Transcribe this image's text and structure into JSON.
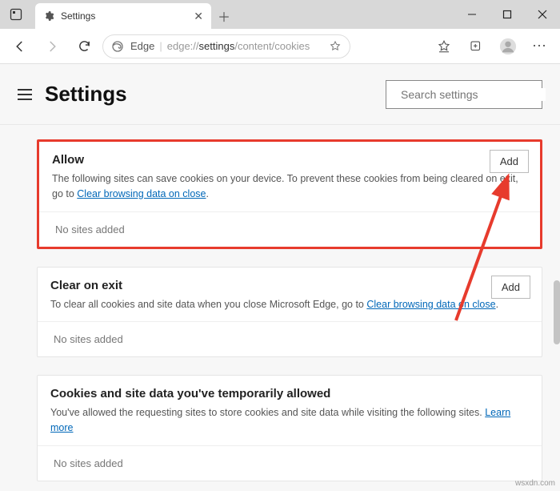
{
  "titlebar": {
    "tab_title": "Settings"
  },
  "toolbar": {
    "addr_label": "Edge",
    "addr_prefix": "edge://",
    "addr_bold": "settings",
    "addr_rest": "/content/cookies"
  },
  "header": {
    "title": "Settings",
    "search_placeholder": "Search settings"
  },
  "cards": {
    "allow": {
      "title": "Allow",
      "desc_pre": "The following sites can save cookies on your device. To prevent these cookies from being cleared on exit, go to ",
      "link": "Clear browsing data on close",
      "desc_post": ".",
      "add": "Add",
      "empty": "No sites added"
    },
    "clear": {
      "title": "Clear on exit",
      "desc_pre": "To clear all cookies and site data when you close Microsoft Edge, go to ",
      "link": "Clear browsing data on close",
      "desc_post": ".",
      "add": "Add",
      "empty": "No sites added"
    },
    "temp": {
      "title": "Cookies and site data you've temporarily allowed",
      "desc_pre": "You've allowed the requesting sites to store cookies and site data while visiting the following sites. ",
      "link": "Learn more",
      "empty": "No sites added"
    }
  },
  "watermark": "wsxdn.com"
}
